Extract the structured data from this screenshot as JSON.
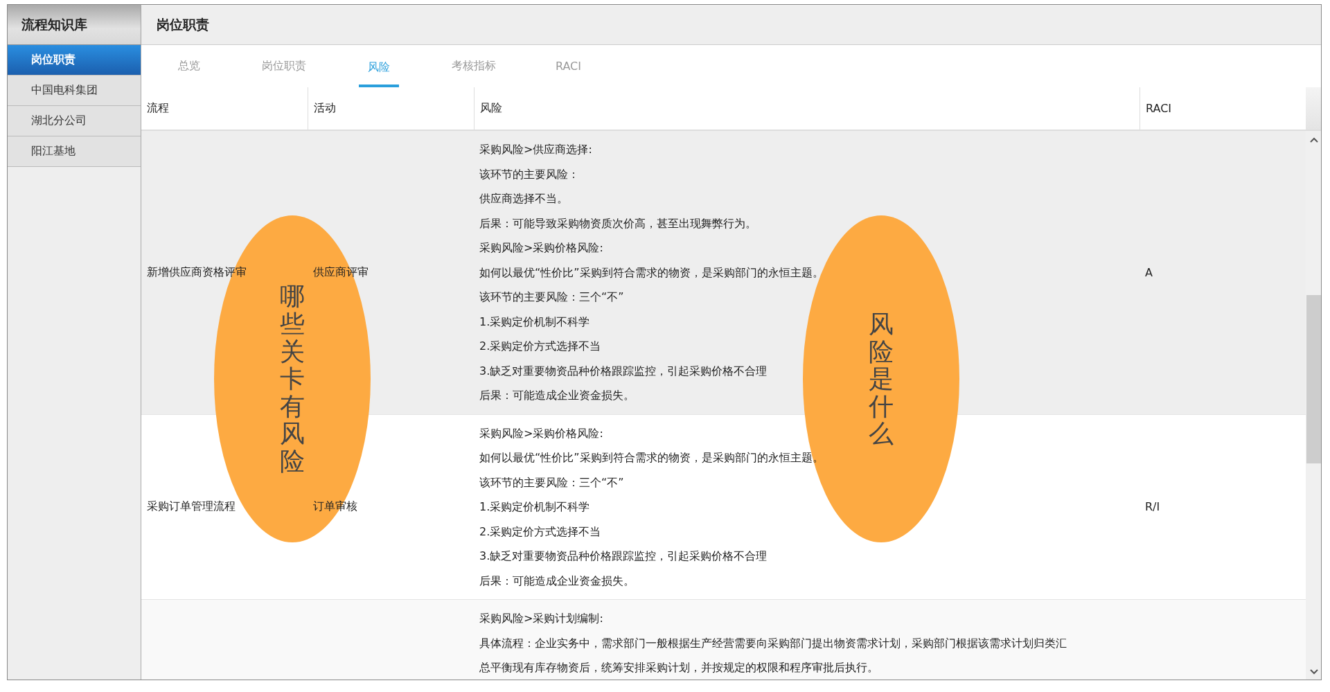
{
  "sidebar": {
    "title": "流程知识库",
    "items": [
      {
        "label": "岗位职责",
        "selected": true
      },
      {
        "label": "中国电科集团",
        "selected": false
      },
      {
        "label": "湖北分公司",
        "selected": false
      },
      {
        "label": "阳江基地",
        "selected": false
      }
    ]
  },
  "header": {
    "title": "岗位职责"
  },
  "tabs": [
    {
      "label": "总览",
      "selected": false
    },
    {
      "label": "岗位职责",
      "selected": false
    },
    {
      "label": "风险",
      "selected": true
    },
    {
      "label": "考核指标",
      "selected": false
    },
    {
      "label": "RACI",
      "selected": false
    }
  ],
  "table": {
    "columns": [
      "流程",
      "活动",
      "风险",
      "RACI"
    ],
    "rows": [
      {
        "process": "新增供应商资格评审",
        "activity": "供应商评审",
        "risk": [
          "采购风险>供应商选择:",
          "该环节的主要风险：",
          "供应商选择不当。",
          "后果：可能导致采购物资质次价高，甚至出现舞弊行为。",
          "采购风险>采购价格风险:",
          "如何以最优“性价比”采购到符合需求的物资，是采购部门的永恒主题。",
          "该环节的主要风险：三个“不”",
          "1.采购定价机制不科学",
          "2.采购定价方式选择不当",
          "3.缺乏对重要物资品种价格跟踪监控，引起采购价格不合理",
          "后果：可能造成企业资金损失。"
        ],
        "raci": "A"
      },
      {
        "process": "采购订单管理流程",
        "activity": "订单审核",
        "risk": [
          "采购风险>采购价格风险:",
          "如何以最优“性价比”采购到符合需求的物资，是采购部门的永恒主题。",
          "该环节的主要风险：三个“不”",
          "1.采购定价机制不科学",
          "2.采购定价方式选择不当",
          "3.缺乏对重要物资品种价格跟踪监控，引起采购价格不合理",
          "后果：可能造成企业资金损失。"
        ],
        "raci": "R/I"
      },
      {
        "risk": [
          "采购风险>采购计划编制:",
          "具体流程：企业实务中，需求部门一般根据生产经营需要向采购部门提出物资需求计划，采购部门根据该需求计划归类汇",
          "总平衡现有库存物资后，统筹安排采购计划，并按规定的权限和程序审批后执行。"
        ]
      }
    ]
  },
  "annotations": [
    {
      "text": "哪些关卡有风险"
    },
    {
      "text": "风险是什么"
    }
  ]
}
